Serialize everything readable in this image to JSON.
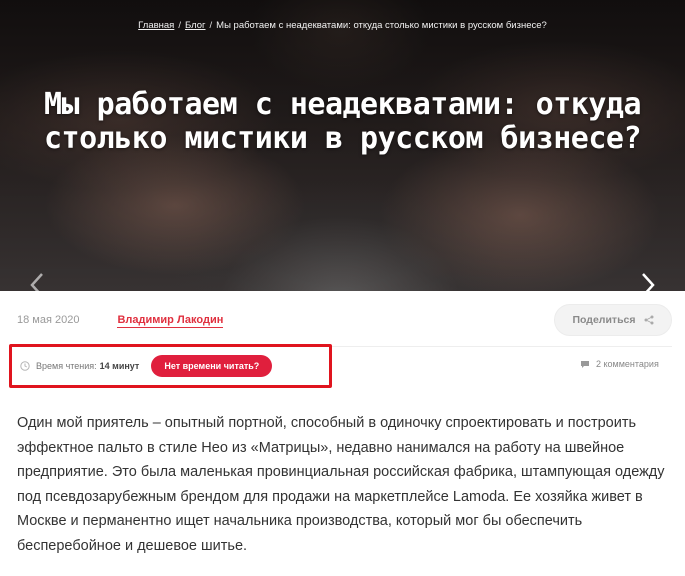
{
  "breadcrumb": {
    "home": "Главная",
    "blog": "Блог",
    "current": "Мы работаем с неадекватами: откуда столько мистики в русском бизнесе?",
    "separator": "/"
  },
  "hero": {
    "title": "Мы работаем с неадекватами: откуда столько мистики в русском бизнесе?",
    "prev_icon": "chevron-left-icon",
    "next_icon": "chevron-right-icon"
  },
  "meta": {
    "date": "18 мая 2020",
    "author": "Владимир Лакодин",
    "share_label": "Поделиться",
    "share_icon": "share-icon"
  },
  "reading": {
    "label": "Время чтения:",
    "value": "14 минут",
    "no_time_button": "Нет времени читать?",
    "clock_icon": "clock-icon"
  },
  "comments": {
    "label": "2 комментария",
    "icon": "comment-icon"
  },
  "article": {
    "paragraph": "Один мой приятель – опытный портной, способный в одиночку спроектировать и построить эффектное пальто в стиле Нео из «Матрицы», недавно нанимался на работу на швейное предприятие. Это была маленькая провинциальная российская фабрика, штампующая одежду под псевдозарубежным брендом для продажи на маркетплейсе Lamoda. Ее хозяйка живет в Москве и перманентно ищет начальника производства, который мог бы обеспечить бесперебойное и дешевое шитье."
  },
  "colors": {
    "accent": "#e01f3d",
    "highlight_border": "#e0141e",
    "author": "#e0303f"
  }
}
